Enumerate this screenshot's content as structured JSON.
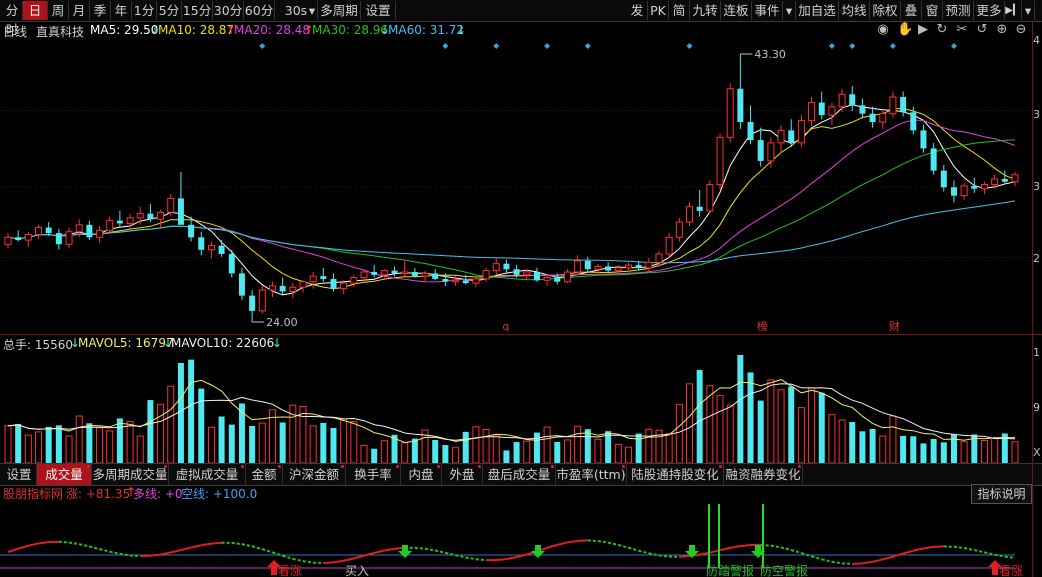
{
  "toolbar": {
    "left_items": [
      "分时",
      "日",
      "周",
      "月",
      "季",
      "年",
      "1分",
      "5分",
      "15分",
      "30分",
      "60分",
      "30s",
      "多周期",
      "设置"
    ],
    "selected": "日",
    "right_items": [
      "发",
      "PK",
      "简",
      "九转",
      "连板",
      "事件",
      "加自选",
      "均线",
      "除权",
      "叠",
      "窗",
      "预测",
      "更多"
    ]
  },
  "info": {
    "period": "日线",
    "name": "直真科技",
    "ma5": "MA5: 29.50",
    "ma10": "MA10: 28.87",
    "ma20": "MA20: 28.48",
    "ma30": "MA30: 28.96",
    "ma60": "MA60: 31.72",
    "colors": {
      "ma5": "#ffffff",
      "ma10": "#f0e000",
      "ma20": "#e040e0",
      "ma30": "#20c020",
      "ma60": "#40c0f0"
    }
  },
  "price_chart": {
    "high_label": "43.30",
    "low_label": "24.00",
    "markers": [
      "q",
      "榜",
      "财"
    ],
    "right_ticks": [
      "4",
      "3",
      "3",
      "2"
    ],
    "colors": {
      "up": "#ff3030",
      "down": "#50e8f0"
    }
  },
  "volume": {
    "label": "总手: 15560",
    "mavol5": "MAVOL5: 16797",
    "mavol10": "MAVOL10: 22606",
    "right_ticks": [
      "1",
      "9",
      "X"
    ]
  },
  "tabs": [
    "设置",
    "成交量",
    "多周期成交量",
    "虚拟成交量",
    "金额",
    "沪深金额",
    "换手率",
    "内盘",
    "外盘",
    "盘后成交量",
    "市盈率(ttm)",
    "陆股通持股变化",
    "融资融券变化"
  ],
  "selected_tab": "成交量",
  "indicator": {
    "name": "股朋指标网",
    "zhang": "涨: +81.35",
    "duo": "多线: +0",
    "kong": "空线: +100.0",
    "button": "指标说明",
    "labels": [
      "看涨",
      "买入",
      "防踏警报",
      "防空警报",
      "看涨"
    ]
  },
  "chart_data": {
    "type": "candlestick",
    "ohlc": [
      [
        29.6,
        30.4,
        29.3,
        30.1
      ],
      [
        30.1,
        30.6,
        29.8,
        29.9
      ],
      [
        29.9,
        30.5,
        29.4,
        30.3
      ],
      [
        30.3,
        31.0,
        30.0,
        30.8
      ],
      [
        30.8,
        31.2,
        30.2,
        30.4
      ],
      [
        30.4,
        30.7,
        29.2,
        29.6
      ],
      [
        29.6,
        30.8,
        29.3,
        30.5
      ],
      [
        30.5,
        31.4,
        30.1,
        31.0
      ],
      [
        31.0,
        31.3,
        29.9,
        30.1
      ],
      [
        30.1,
        30.9,
        29.7,
        30.6
      ],
      [
        30.6,
        31.6,
        30.3,
        31.3
      ],
      [
        31.3,
        32.0,
        30.8,
        31.1
      ],
      [
        31.1,
        31.8,
        30.6,
        31.5
      ],
      [
        31.5,
        32.3,
        31.0,
        31.8
      ],
      [
        31.8,
        32.5,
        31.2,
        31.4
      ],
      [
        31.4,
        32.1,
        30.8,
        31.9
      ],
      [
        31.9,
        33.2,
        31.6,
        32.9
      ],
      [
        32.9,
        34.8,
        32.4,
        31.0
      ],
      [
        31.0,
        31.6,
        29.8,
        30.1
      ],
      [
        30.1,
        30.5,
        28.8,
        29.2
      ],
      [
        29.2,
        29.8,
        28.6,
        29.5
      ],
      [
        29.5,
        29.9,
        28.7,
        28.9
      ],
      [
        28.9,
        29.2,
        27.2,
        27.5
      ],
      [
        27.5,
        27.9,
        25.6,
        25.9
      ],
      [
        25.9,
        26.3,
        24.0,
        24.8
      ],
      [
        24.8,
        26.6,
        24.6,
        26.3
      ],
      [
        26.3,
        26.9,
        25.8,
        26.6
      ],
      [
        26.6,
        27.2,
        26.0,
        26.2
      ],
      [
        26.2,
        26.8,
        25.7,
        26.5
      ],
      [
        26.5,
        27.0,
        26.1,
        26.9
      ],
      [
        26.9,
        27.6,
        26.4,
        27.3
      ],
      [
        27.3,
        27.9,
        26.9,
        27.1
      ],
      [
        27.1,
        27.5,
        26.2,
        26.4
      ],
      [
        26.4,
        27.0,
        26.0,
        26.8
      ],
      [
        26.8,
        27.4,
        26.5,
        27.2
      ],
      [
        27.2,
        27.8,
        26.9,
        27.6
      ],
      [
        27.6,
        28.1,
        27.2,
        27.4
      ],
      [
        27.4,
        27.8,
        27.0,
        27.7
      ],
      [
        27.7,
        28.0,
        27.3,
        27.5
      ],
      [
        27.5,
        28.4,
        27.3,
        27.6
      ],
      [
        27.6,
        27.9,
        27.2,
        27.3
      ],
      [
        27.3,
        27.7,
        26.9,
        27.5
      ],
      [
        27.5,
        27.8,
        27.0,
        27.1
      ],
      [
        27.1,
        27.5,
        26.6,
        26.9
      ],
      [
        26.9,
        27.3,
        26.6,
        27.0
      ],
      [
        27.0,
        27.4,
        26.7,
        26.8
      ],
      [
        26.8,
        27.2,
        26.5,
        27.1
      ],
      [
        27.1,
        27.9,
        26.9,
        27.7
      ],
      [
        27.7,
        28.6,
        27.4,
        28.2
      ],
      [
        28.2,
        28.5,
        27.5,
        27.8
      ],
      [
        27.8,
        28.1,
        27.2,
        27.4
      ],
      [
        27.4,
        27.8,
        27.0,
        27.6
      ],
      [
        27.6,
        27.9,
        26.9,
        27.0
      ],
      [
        27.0,
        27.4,
        26.6,
        27.2
      ],
      [
        27.2,
        27.5,
        26.7,
        26.9
      ],
      [
        26.9,
        27.8,
        26.8,
        27.6
      ],
      [
        27.6,
        28.8,
        27.4,
        28.4
      ],
      [
        28.4,
        28.7,
        27.6,
        27.8
      ],
      [
        27.8,
        28.2,
        27.4,
        28.0
      ],
      [
        28.0,
        28.3,
        27.6,
        27.7
      ],
      [
        27.7,
        28.1,
        27.4,
        27.9
      ],
      [
        27.9,
        28.3,
        27.5,
        28.1
      ],
      [
        28.1,
        28.4,
        27.7,
        27.9
      ],
      [
        27.9,
        28.6,
        27.6,
        28.3
      ],
      [
        28.3,
        29.1,
        28.0,
        28.9
      ],
      [
        28.9,
        30.4,
        28.6,
        30.1
      ],
      [
        30.1,
        31.5,
        29.8,
        31.2
      ],
      [
        31.2,
        32.6,
        30.9,
        32.3
      ],
      [
        32.3,
        33.5,
        31.6,
        32.0
      ],
      [
        32.0,
        34.2,
        31.8,
        33.9
      ],
      [
        33.9,
        37.6,
        33.5,
        37.3
      ],
      [
        37.3,
        41.2,
        36.9,
        40.8
      ],
      [
        40.8,
        43.3,
        37.9,
        38.4
      ],
      [
        38.4,
        39.6,
        36.8,
        37.1
      ],
      [
        37.1,
        38.0,
        35.2,
        35.6
      ],
      [
        35.6,
        37.3,
        35.1,
        36.9
      ],
      [
        36.9,
        38.2,
        36.2,
        37.8
      ],
      [
        37.8,
        38.6,
        36.6,
        36.9
      ],
      [
        36.9,
        38.9,
        36.6,
        38.5
      ],
      [
        38.5,
        40.2,
        38.1,
        39.8
      ],
      [
        39.8,
        40.6,
        38.6,
        38.9
      ],
      [
        38.9,
        39.8,
        38.2,
        39.5
      ],
      [
        39.5,
        40.8,
        39.1,
        40.4
      ],
      [
        40.4,
        41.0,
        39.2,
        39.6
      ],
      [
        39.6,
        40.1,
        38.7,
        39.0
      ],
      [
        39.0,
        39.5,
        38.0,
        38.4
      ],
      [
        38.4,
        39.2,
        37.9,
        39.0
      ],
      [
        39.0,
        40.6,
        38.7,
        40.2
      ],
      [
        40.2,
        40.6,
        38.8,
        39.1
      ],
      [
        39.1,
        39.5,
        37.5,
        37.8
      ],
      [
        37.8,
        38.2,
        36.2,
        36.5
      ],
      [
        36.5,
        36.9,
        34.6,
        34.9
      ],
      [
        34.9,
        35.3,
        33.4,
        33.7
      ],
      [
        33.7,
        34.2,
        32.6,
        33.1
      ],
      [
        33.1,
        34.0,
        32.8,
        33.8
      ],
      [
        33.8,
        34.4,
        33.3,
        33.6
      ],
      [
        33.6,
        34.1,
        33.2,
        33.9
      ],
      [
        33.9,
        34.6,
        33.6,
        34.3
      ],
      [
        34.3,
        34.9,
        33.9,
        34.1
      ],
      [
        34.1,
        34.8,
        33.8,
        34.6
      ]
    ]
  }
}
